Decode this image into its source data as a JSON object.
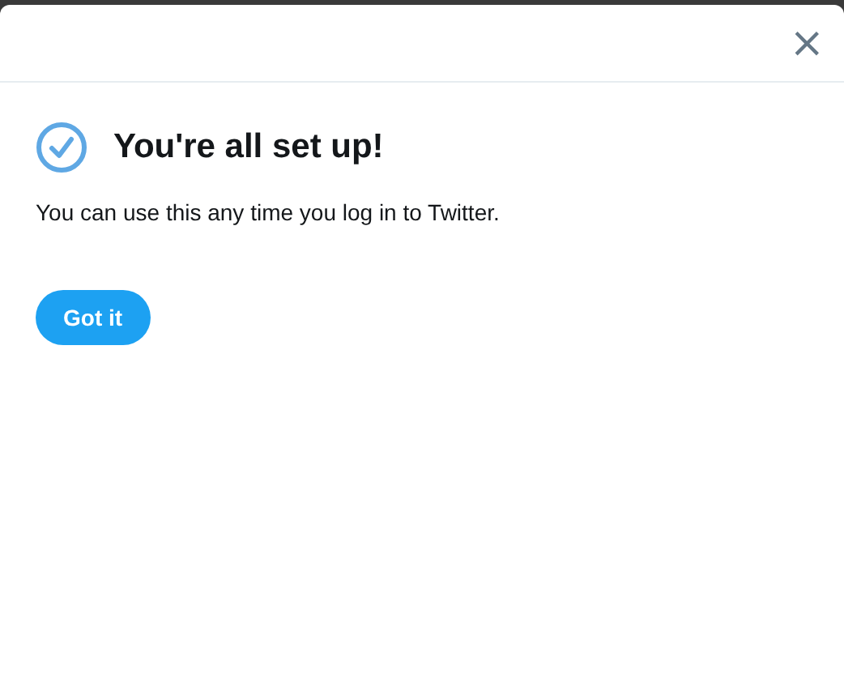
{
  "dialog": {
    "close": "×",
    "title": "You're all set up!",
    "message": "You can use this any time you log in to Twitter.",
    "button": "Got it"
  }
}
